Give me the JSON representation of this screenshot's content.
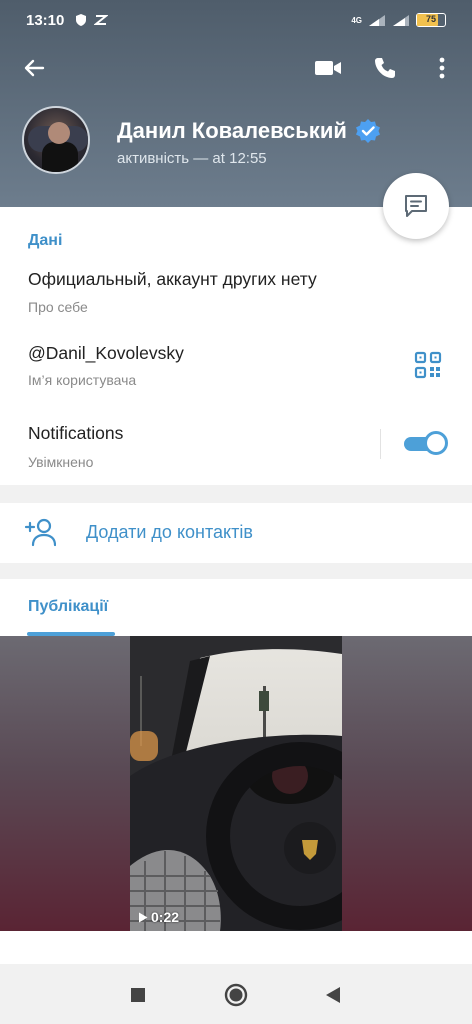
{
  "status_bar": {
    "time": "13:10",
    "network": "4G",
    "battery": "75"
  },
  "header": {
    "back_icon": "arrow-left-icon",
    "video_icon": "video-camera-icon",
    "call_icon": "phone-icon",
    "more_icon": "more-vertical-icon",
    "name": "Данил Ковалевський",
    "verified_icon": "verified-badge-icon",
    "last_seen": "активність — at 12:55",
    "colors": {
      "gradient_top": "#4f5d6b",
      "gradient_bottom": "#6d7d8d"
    }
  },
  "fab": {
    "icon": "message-icon"
  },
  "info": {
    "section_title": "Дані",
    "bio": "Официальный, аккаунт других нету",
    "bio_label": "Про себе",
    "username": "@Danil_Kovolevsky",
    "username_label": "Ім’я користувача",
    "qr_icon": "qr-code-icon",
    "notifications": "Notifications",
    "notifications_state": "Увімкнено",
    "notifications_on": true
  },
  "contacts": {
    "icon": "add-contact-icon",
    "label": "Додати до контактів"
  },
  "posts": {
    "tab": "Публікації",
    "video_duration": "0:22",
    "play_icon": "play-icon"
  },
  "navbar": {
    "square_icon": "recent-apps-icon",
    "circle_icon": "home-icon",
    "triangle_icon": "back-triangle-icon"
  },
  "accent_color": "#3f90c9"
}
